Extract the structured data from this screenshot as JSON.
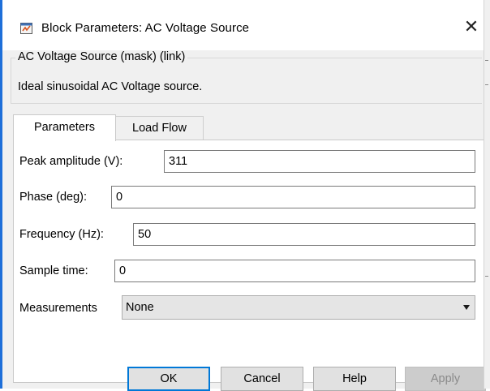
{
  "window": {
    "title": "Block Parameters: AC Voltage Source",
    "close_glyph": "✕",
    "icon": "simulink-block-icon"
  },
  "description": {
    "group_title": "AC Voltage Source (mask) (link)",
    "text": "Ideal sinusoidal AC Voltage source."
  },
  "tabs": [
    {
      "label": "Parameters",
      "active": true
    },
    {
      "label": "Load Flow",
      "active": false
    }
  ],
  "parameters": {
    "peak_amplitude": {
      "label": "Peak amplitude (V):",
      "value": "311"
    },
    "phase": {
      "label": "Phase (deg):",
      "value": "0"
    },
    "frequency": {
      "label": "Frequency (Hz):",
      "value": "50"
    },
    "sample_time": {
      "label": "Sample time:",
      "value": "0"
    },
    "measurements": {
      "label": "Measurements",
      "selected": "None"
    }
  },
  "buttons": {
    "ok": "OK",
    "cancel": "Cancel",
    "help": "Help",
    "apply": "Apply"
  },
  "colors": {
    "accent": "#0078d7",
    "window_border": "#1e6fd9",
    "dialog_bg": "#f0f0f0",
    "panel_bg": "#ffffff"
  }
}
